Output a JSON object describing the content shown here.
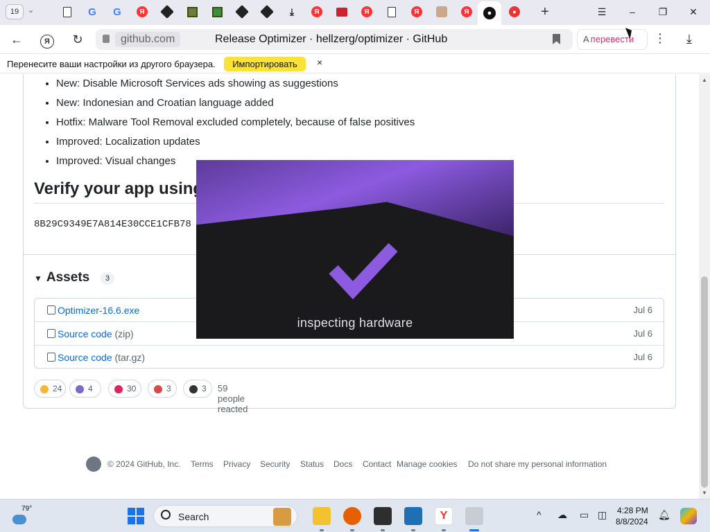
{
  "browser": {
    "tab_count": "19",
    "address_domain": "github.com",
    "page_title": "Release Optimizer · hellzerg/optimizer · GitHub",
    "translate_label": "перевести",
    "translate_glyph": "A"
  },
  "import_bar": {
    "message": "Перенесите ваши настройки из другого браузера.",
    "button": "Импортировать",
    "close": "×"
  },
  "release": {
    "changes": [
      "New: Disable Microsoft Services ads showing as suggestions",
      "New: Indonesian and Croatian language added",
      "Hotfix: Malware Tool Removal excluded completely, because of false positives",
      "Improved: Localization updates",
      "Improved: Visual changes"
    ],
    "verify_heading": "Verify your app using",
    "hash": "8B29C9349E7A814E30CCE1CFB78"
  },
  "assets": {
    "heading": "Assets",
    "count": "3",
    "items": [
      {
        "name": "Optimizer-16.6.exe",
        "suffix": "",
        "date": "Jul 6"
      },
      {
        "name": "Source code",
        "suffix": "(zip)",
        "date": "Jul 6"
      },
      {
        "name": "Source code",
        "suffix": "(tar.gz)",
        "date": "Jul 6"
      }
    ]
  },
  "reactions": {
    "items": [
      {
        "emoji": "thumbs-up",
        "count": "24",
        "color": "#f5b73b"
      },
      {
        "emoji": "tada",
        "count": "4",
        "color": "#7a6cc4"
      },
      {
        "emoji": "heart",
        "count": "30",
        "color": "#e0245e"
      },
      {
        "emoji": "rocket",
        "count": "3",
        "color": "#d94a4a"
      },
      {
        "emoji": "eyes",
        "count": "3",
        "color": "#333333"
      }
    ],
    "summary": "59 people reacted"
  },
  "footer": {
    "copyright": "© 2024 GitHub, Inc.",
    "links": [
      "Terms",
      "Privacy",
      "Security",
      "Status",
      "Docs",
      "Contact",
      "Manage cookies",
      "Do not share my personal information"
    ]
  },
  "overlay": {
    "caption": "inspecting hardware",
    "accent": "#8c5be0"
  },
  "taskbar": {
    "temperature": "79°",
    "search_label": "Search",
    "time": "4:28 PM",
    "date": "8/8/2024"
  }
}
